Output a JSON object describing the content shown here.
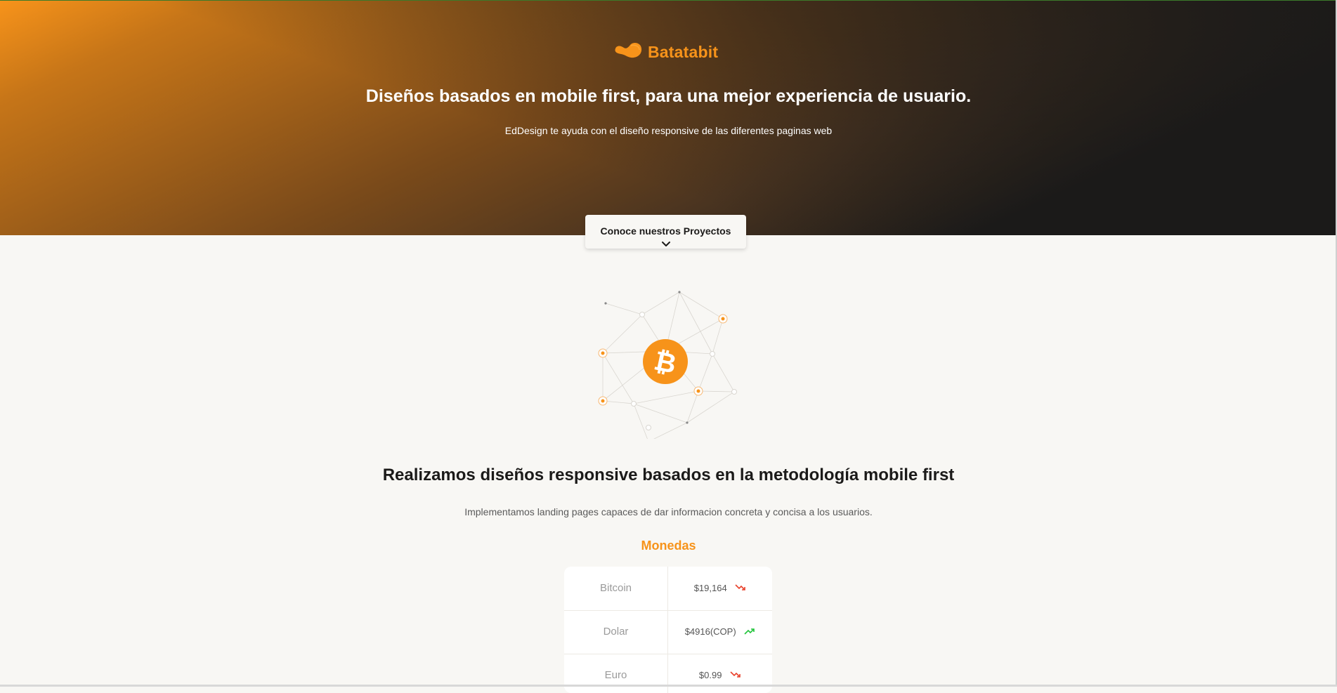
{
  "brand": {
    "name": "Batatabit",
    "logo_icon": "batata-logo-icon",
    "accent_color": "#f7931a"
  },
  "hero": {
    "title": "Diseños basados en mobile first, para una mejor experiencia de usuario.",
    "subtitle": "EdDesign te ayuda con el diseño responsive de las diferentes paginas web",
    "cta_label": "Conoce nuestros Proyectos",
    "cta_icon": "chevron-down-icon"
  },
  "illustration": {
    "icon": "bitcoin-network-icon",
    "center_icon": "bitcoin-icon"
  },
  "section": {
    "title": "Realizamos diseños responsive basados en la metodología mobile first",
    "description": "Implementamos landing pages capaces de dar informacion concreta y concisa a los usuarios."
  },
  "coins": {
    "title": "Monedas",
    "rows": [
      {
        "name": "Bitcoin",
        "value": "$19,164",
        "trend": "down",
        "trend_color": "#e8412b"
      },
      {
        "name": "Dolar",
        "value": "$4916(COP)",
        "trend": "up",
        "trend_color": "#20c43a"
      },
      {
        "name": "Euro",
        "value": "$0.99",
        "trend": "down",
        "trend_color": "#e8412b"
      }
    ]
  }
}
